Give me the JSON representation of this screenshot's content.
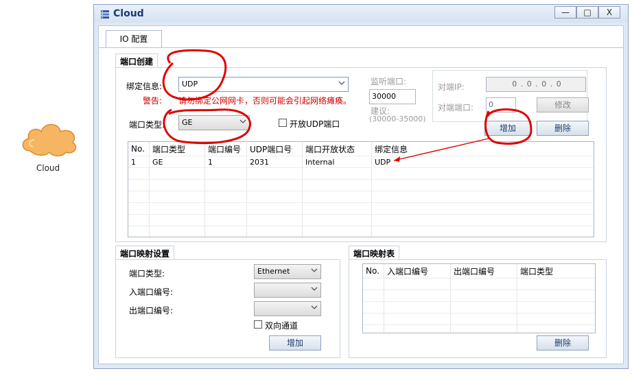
{
  "desktop": {
    "cloud_label": "Cloud"
  },
  "window": {
    "title": "Cloud",
    "minimize": "—",
    "maximize": "□",
    "close": "X"
  },
  "tabs": [
    {
      "label": "IO 配置"
    }
  ],
  "port_create": {
    "section_title": "端口创建",
    "binding_label": "绑定信息:",
    "binding_value": "UDP",
    "warning_label": "警告:",
    "warning_text": "请勿绑定公网网卡，否则可能会引起网络瘫痪。",
    "port_type_label": "端口类型:",
    "port_type_value": "GE",
    "open_udp_label": "开放UDP端口",
    "listen_port_label": "监听端口:",
    "listen_port_value": "30000",
    "suggest_label": "建议:",
    "suggest_value": "(30000-35000)",
    "peer_ip_label": "对端IP:",
    "peer_ip_value": "0 . 0 . 0 . 0",
    "peer_port_label": "对端端口:",
    "peer_port_value": "0",
    "modify_button": "修改",
    "add_button": "增加",
    "delete_button": "删除",
    "table": {
      "headers": [
        "No.",
        "端口类型",
        "端口编号",
        "UDP端口号",
        "端口开放状态",
        "绑定信息"
      ],
      "rows": [
        [
          "1",
          "GE",
          "1",
          "2031",
          "Internal",
          "UDP"
        ]
      ]
    }
  },
  "port_mapping": {
    "section_title": "端口映射设置",
    "port_type_label": "端口类型:",
    "port_type_value": "Ethernet",
    "in_port_label": "入端口编号:",
    "out_port_label": "出端口编号:",
    "bidirectional_label": "双向通道",
    "add_button": "增加"
  },
  "mapping_table": {
    "section_title": "端口映射表",
    "headers": [
      "No.",
      "入端口编号",
      "出端口编号",
      "端口类型"
    ],
    "delete_button": "删除"
  },
  "colors": {
    "annotation": "#e00000",
    "accent": "#1c3a6e"
  }
}
